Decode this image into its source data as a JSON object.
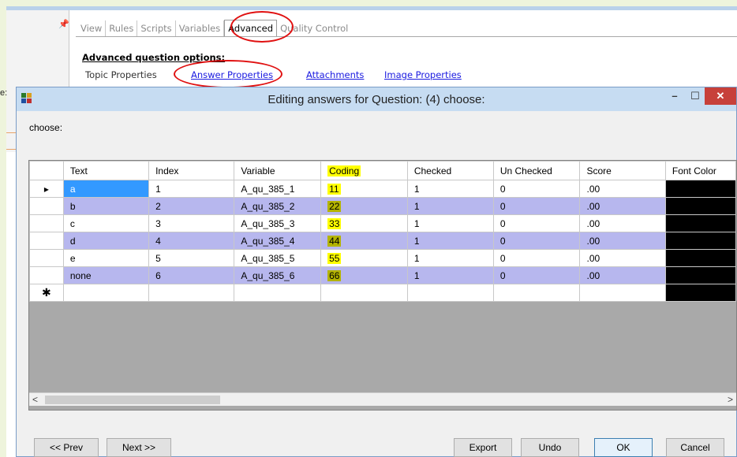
{
  "background_app": {
    "tabs": [
      "View",
      "Rules",
      "Scripts",
      "Variables",
      "Advanced",
      "Quality Control"
    ],
    "active_tab": "Advanced",
    "section_title": "Advanced question options:",
    "links": [
      {
        "label": "Topic Properties",
        "is_link": false
      },
      {
        "label": "Answer Properties",
        "is_link": true
      },
      {
        "label": "Attachments",
        "is_link": true
      },
      {
        "label": "Image Properties",
        "is_link": true
      }
    ],
    "side_label": "e:"
  },
  "dialog": {
    "title": "Editing answers for Question: (4) choose:",
    "prompt": "choose:",
    "window_buttons": {
      "minimize": "–",
      "maximize": "☐",
      "close": "✕"
    },
    "columns": [
      "Text",
      "Index",
      "Variable",
      "Coding",
      "Checked",
      "Un Checked",
      "Score",
      "Font Color"
    ],
    "rows": [
      {
        "text": "a",
        "index": "1",
        "variable": "A_qu_385_1",
        "coding": "11",
        "checked": "1",
        "unchecked": "0",
        "score": ".00"
      },
      {
        "text": "b",
        "index": "2",
        "variable": "A_qu_385_2",
        "coding": "22",
        "checked": "1",
        "unchecked": "0",
        "score": ".00"
      },
      {
        "text": "c",
        "index": "3",
        "variable": "A_qu_385_3",
        "coding": "33",
        "checked": "1",
        "unchecked": "0",
        "score": ".00"
      },
      {
        "text": "d",
        "index": "4",
        "variable": "A_qu_385_4",
        "coding": "44",
        "checked": "1",
        "unchecked": "0",
        "score": ".00"
      },
      {
        "text": "e",
        "index": "5",
        "variable": "A_qu_385_5",
        "coding": "55",
        "checked": "1",
        "unchecked": "0",
        "score": ".00"
      },
      {
        "text": "none",
        "index": "6",
        "variable": "A_qu_385_6",
        "coding": "66",
        "checked": "1",
        "unchecked": "0",
        "score": ".00"
      }
    ],
    "current_row_marker": "▸",
    "new_row_marker": "✱",
    "scroll": {
      "left": "<",
      "right": ">"
    },
    "buttons": {
      "prev": "<< Prev",
      "next": "Next >>",
      "export": "Export",
      "undo": "Undo",
      "ok": "OK",
      "cancel": "Cancel"
    }
  },
  "colors": {
    "row_alt": "#b7b7ee",
    "selected_cell": "#3399ff",
    "highlight_yellow": "#ffff00",
    "highlight_olive": "#b3b300",
    "annotation_red": "#e01010",
    "font_color_swatch": "#000000",
    "close_button": "#c7403a"
  },
  "icons": {
    "pin": "pin-icon",
    "app": "app-icon"
  }
}
